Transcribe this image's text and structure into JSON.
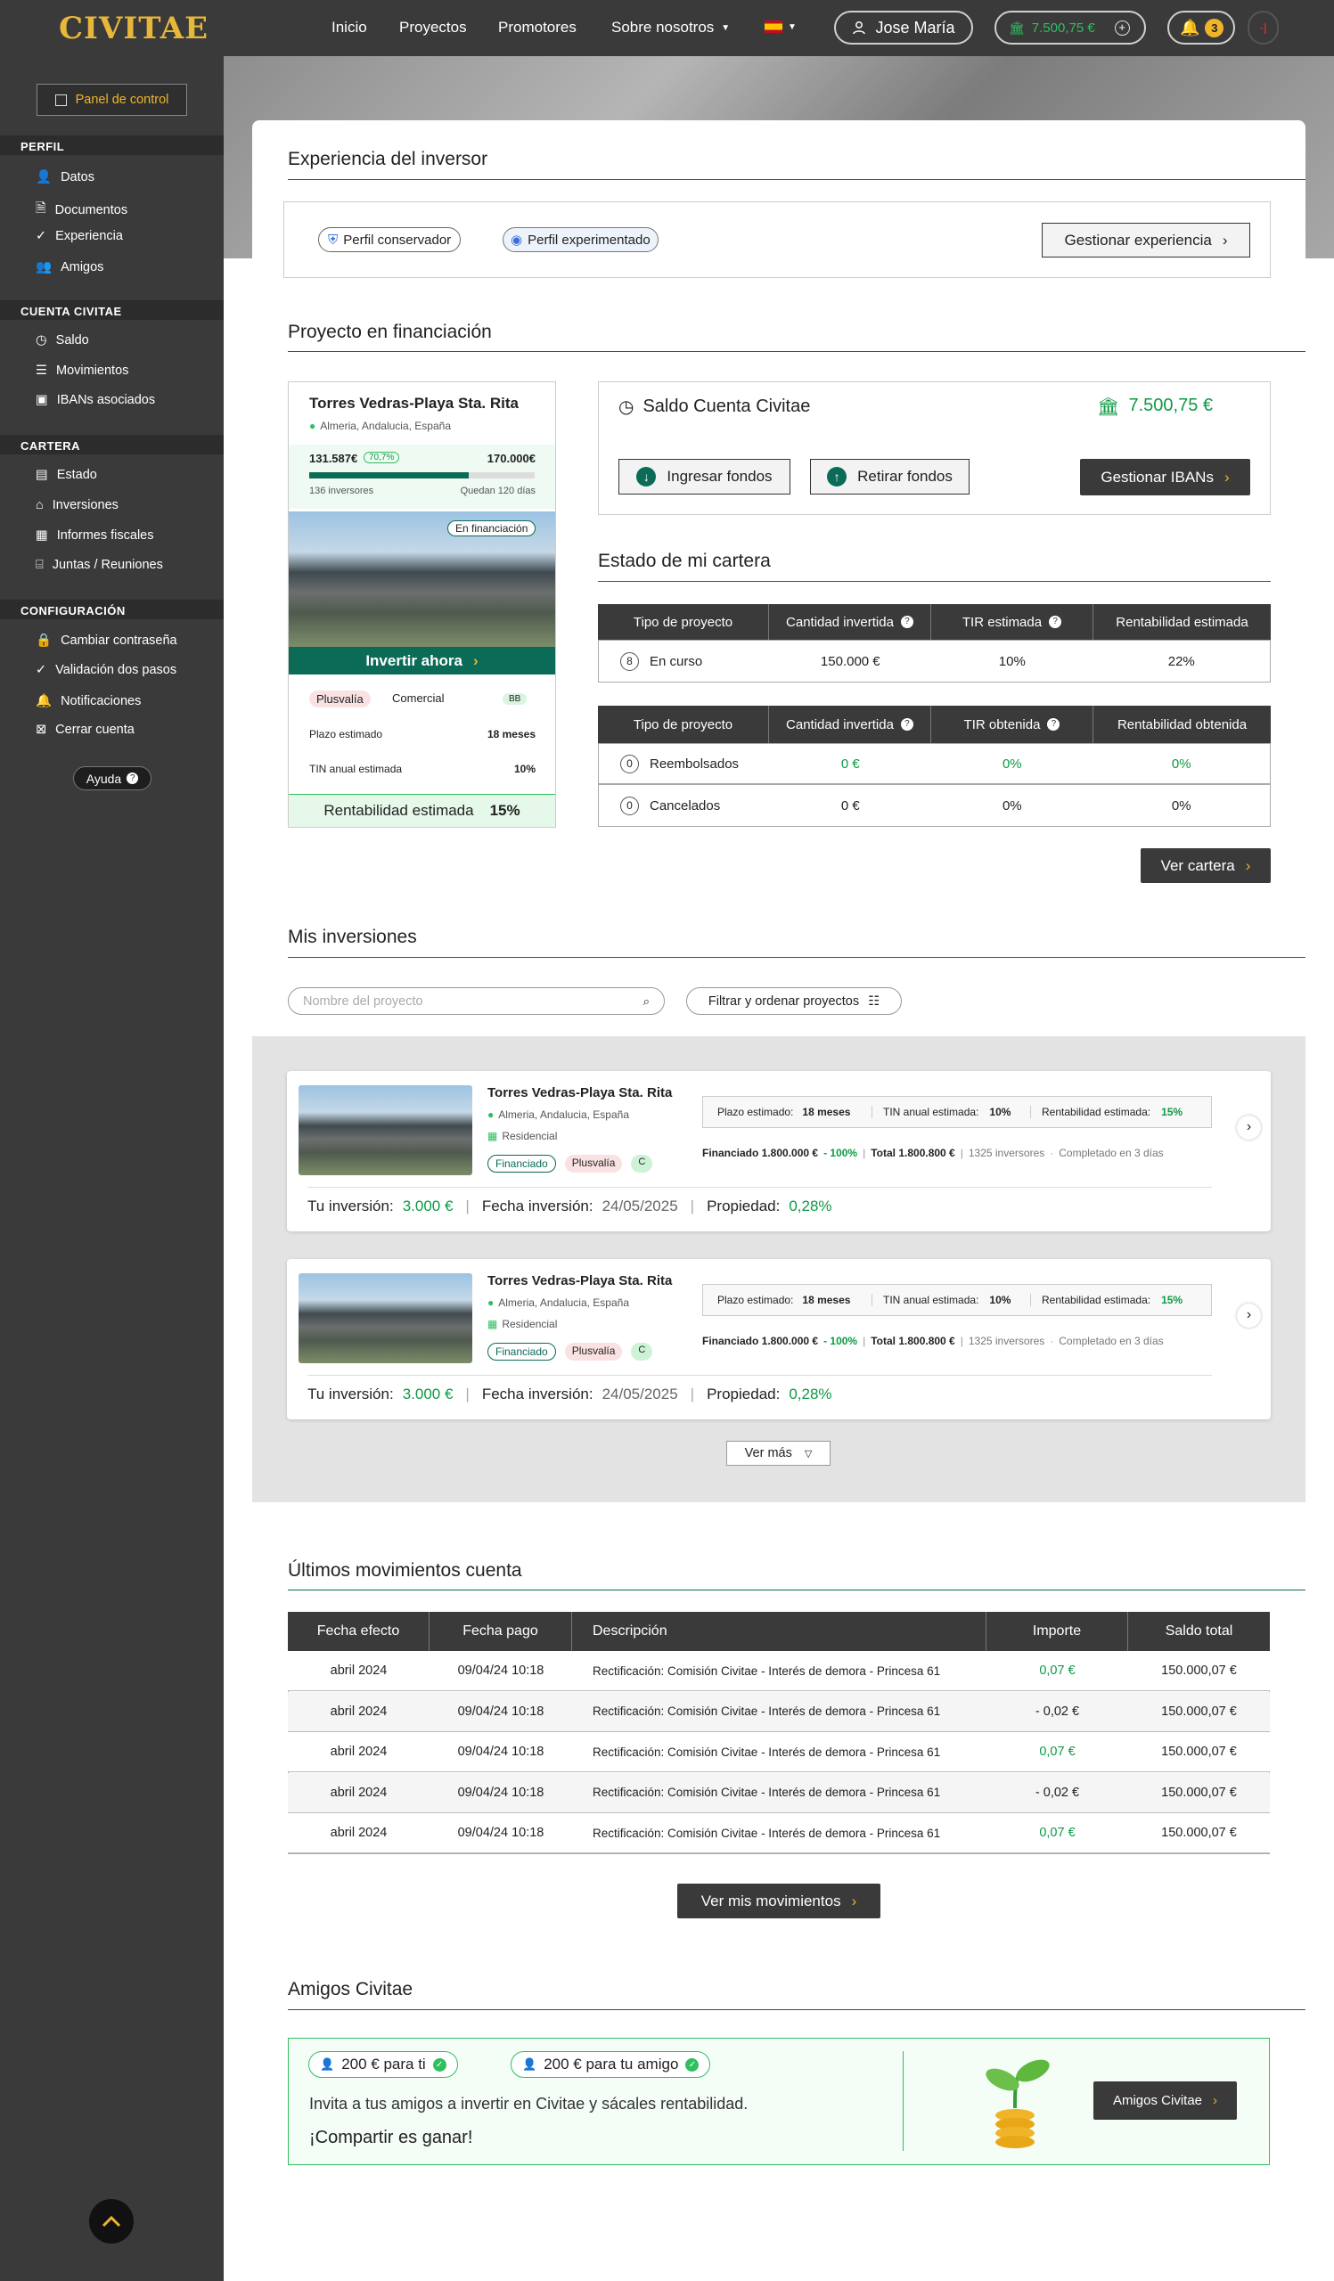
{
  "header": {
    "logo": "CIVITAE",
    "nav": [
      "Inicio",
      "Proyectos",
      "Promotores",
      "Sobre nosotros"
    ],
    "user": "Jose María",
    "balance": "7.500,75 €",
    "notifications": "3",
    "logout": "-]"
  },
  "sidebar": {
    "panel": "Panel de control",
    "sections": [
      {
        "title": "PERFIL",
        "items": [
          "Datos",
          "Documentos",
          "Experiencia",
          "Amigos"
        ]
      },
      {
        "title": "CUENTA CIVITAE",
        "items": [
          "Saldo",
          "Movimientos",
          "IBANs asociados"
        ]
      },
      {
        "title": "CARTERA",
        "items": [
          "Estado",
          "Inversiones",
          "Informes fiscales",
          "Juntas / Reuniones"
        ]
      },
      {
        "title": "CONFIGURACIÓN",
        "items": [
          "Cambiar contraseña",
          "Validación dos pasos",
          "Notificaciones",
          "Cerrar cuenta"
        ]
      }
    ],
    "help": "Ayuda"
  },
  "experience": {
    "title": "Experiencia del inversor",
    "profile1": "Perfil conservador",
    "profile2": "Perfil experimentado",
    "manage": "Gestionar experiencia"
  },
  "financing": {
    "title": "Proyecto en financiación",
    "project": {
      "name": "Torres Vedras-Playa Sta. Rita",
      "location": "Almeria, Andalucia, España",
      "raised": "131.587€",
      "pct": "70,7%",
      "goal": "170.000€",
      "progress": 0.707,
      "investors": "136 inversores",
      "left": "Quedan 120 días",
      "status": "En financiación",
      "cta": "Invertir ahora",
      "tag1": "Plusvalía",
      "tag2": "Comercial",
      "rating": "BB",
      "plazo_label": "Plazo estimado",
      "plazo": "18 meses",
      "tin_label": "TIN anual estimada",
      "tin": "10%",
      "rent_label": "Rentabilidad estimada",
      "rent": "15%"
    }
  },
  "account": {
    "title": "Saldo Cuenta Civitae",
    "balance": "7.500,75 €",
    "deposit": "Ingresar fondos",
    "withdraw": "Retirar fondos",
    "ibans": "Gestionar IBANs"
  },
  "portfolio": {
    "title": "Estado de mi cartera",
    "table1": {
      "headers": [
        "Tipo de proyecto",
        "Cantidad invertida",
        "TIR estimada",
        "Rentabilidad estimada"
      ],
      "rows": [
        {
          "count": "8",
          "type": "En curso",
          "amount": "150.000 €",
          "tir": "10%",
          "rent": "22%"
        }
      ]
    },
    "table2": {
      "headers": [
        "Tipo de proyecto",
        "Cantidad invertida",
        "TIR obtenida",
        "Rentabilidad obtenida"
      ],
      "rows": [
        {
          "count": "0",
          "type": "Reembolsados",
          "amount": "0 €",
          "tir": "0%",
          "rent": "0%"
        },
        {
          "count": "0",
          "type": "Cancelados",
          "amount": "0 €",
          "tir": "0%",
          "rent": "0%"
        }
      ]
    },
    "view": "Ver cartera"
  },
  "investments": {
    "title": "Mis inversiones",
    "search_placeholder": "Nombre del proyecto",
    "filter": "Filtrar y ordenar proyectos",
    "more": "Ver más",
    "items": [
      {
        "name": "Torres Vedras-Playa Sta. Rita",
        "location": "Almeria, Andalucia, España",
        "type": "Residencial",
        "tag1": "Financiado",
        "tag2": "Plusvalía",
        "tag3": "C",
        "plazo_label": "Plazo estimado:",
        "plazo": "18 meses",
        "tin_label": "TIN anual estimada:",
        "tin": "10%",
        "rent_label": "Rentabilidad estimada:",
        "rent": "15%",
        "financed": "Financiado 1.800.000 €",
        "financed_pct": "- 100%",
        "total": "Total 1.800.800 €",
        "investors": "1325 inversores",
        "completed": "Completado en 3 días",
        "inv_label": "Tu inversión:",
        "inv": "3.000 €",
        "date_label": "Fecha inversión:",
        "date": "24/05/2025",
        "prop_label": "Propiedad:",
        "prop": "0,28%"
      },
      {
        "name": "Torres Vedras-Playa Sta. Rita",
        "location": "Almeria, Andalucia, España",
        "type": "Residencial",
        "tag1": "Financiado",
        "tag2": "Plusvalía",
        "tag3": "C",
        "plazo_label": "Plazo estimado:",
        "plazo": "18 meses",
        "tin_label": "TIN anual estimada:",
        "tin": "10%",
        "rent_label": "Rentabilidad estimada:",
        "rent": "15%",
        "financed": "Financiado 1.800.000 €",
        "financed_pct": "- 100%",
        "total": "Total 1.800.800 €",
        "investors": "1325 inversores",
        "completed": "Completado en 3 días",
        "inv_label": "Tu inversión:",
        "inv": "3.000 €",
        "date_label": "Fecha inversión:",
        "date": "24/05/2025",
        "prop_label": "Propiedad:",
        "prop": "0,28%"
      }
    ]
  },
  "movements": {
    "title": "Últimos movimientos cuenta",
    "headers": [
      "Fecha efecto",
      "Fecha pago",
      "Descripción",
      "Importe",
      "Saldo total"
    ],
    "rows": [
      {
        "effect": "abril 2024",
        "paid": "09/04/24 10:18",
        "desc": "Rectificación: Comisión Civitae - Interés de demora - Princesa 61",
        "amount": "0,07 €",
        "positive": true,
        "total": "150.000,07 €"
      },
      {
        "effect": "abril 2024",
        "paid": "09/04/24 10:18",
        "desc": "Rectificación: Comisión Civitae - Interés de demora - Princesa 61",
        "amount": "- 0,02 €",
        "positive": false,
        "total": "150.000,07 €"
      },
      {
        "effect": "abril 2024",
        "paid": "09/04/24 10:18",
        "desc": "Rectificación: Comisión Civitae - Interés de demora - Princesa 61",
        "amount": "0,07 €",
        "positive": true,
        "total": "150.000,07 €"
      },
      {
        "effect": "abril 2024",
        "paid": "09/04/24 10:18",
        "desc": "Rectificación: Comisión Civitae - Interés de demora - Princesa 61",
        "amount": "- 0,02 €",
        "positive": false,
        "total": "150.000,07 €"
      },
      {
        "effect": "abril 2024",
        "paid": "09/04/24 10:18",
        "desc": "Rectificación: Comisión Civitae - Interés de demora - Princesa 61",
        "amount": "0,07 €",
        "positive": true,
        "total": "150.000,07 €"
      }
    ],
    "view": "Ver mis movimientos"
  },
  "friends": {
    "title": "Amigos Civitae",
    "reward1": "200 € para ti",
    "reward2": "200 € para tu amigo",
    "text": "Invita a tus amigos a invertir en Civitae y sácales rentabilidad.",
    "slogan": "¡Compartir es ganar!",
    "cta": "Amigos Civitae"
  }
}
